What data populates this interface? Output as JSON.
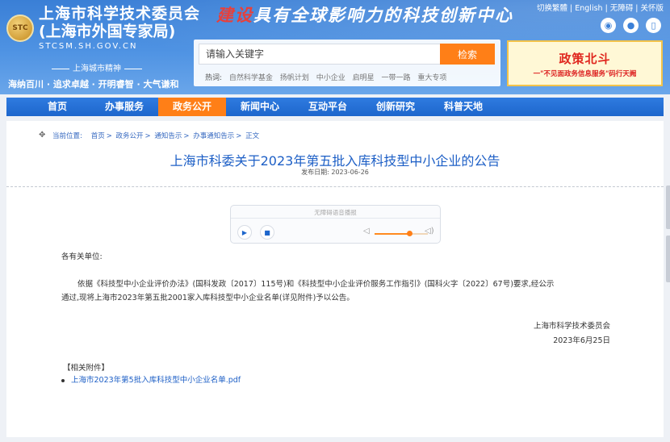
{
  "header": {
    "logo_text": "STC",
    "org_name": "上海市科学技术委员会",
    "org_sub": "(上海市外国专家局)",
    "domain": "STCSM.SH.GOV.CN",
    "spirit_title": "上海城市精神",
    "spirit_text": "海纳百川 · 追求卓越 · 开明睿智 · 大气谦和",
    "slogan_part1": "建设",
    "slogan_part2": "具有全球影响力的科技创新中心",
    "links": [
      "切换繁體",
      "English",
      "无障碍",
      "关怀版"
    ],
    "social_icons": [
      "weibo-icon",
      "wechat-icon",
      "mobile-icon"
    ]
  },
  "search": {
    "placeholder": "请输入关键字",
    "button_label": "检索",
    "hot_label": "热词:",
    "hot_keywords": [
      "自然科学基金",
      "扬帆计划",
      "中小企业",
      "启明星",
      "一带一路",
      "重大专项"
    ]
  },
  "banner": {
    "title": "政策北斗",
    "subtitle": "一\"不见面政务信息服务\"码行天阙"
  },
  "nav": {
    "items": [
      "首页",
      "办事服务",
      "政务公开",
      "新闻中心",
      "互动平台",
      "创新研究",
      "科普天地"
    ],
    "active_index": 2
  },
  "breadcrumb": {
    "label": "当前位置:",
    "items": [
      "首页",
      "政务公开",
      "通知告示",
      "办事通知告示",
      "正文"
    ]
  },
  "article": {
    "title": "上海市科委关于2023年第五批入库科技型中小企业的公告",
    "date_label": "发布日期:",
    "date_value": "2023-06-26",
    "greeting": "各有关单位:",
    "body_line1": "依据《科技型中小企业评价办法》(国科发政〔2017〕115号)和《科技型中小企业评价服务工作指引》(国科火字〔2022〕67号)要求,经公示",
    "body_line2": "通过,现将上海市2023年第五批2001家入库科技型中小企业名单(详见附件)予以公告。",
    "signer": "上海市科学技术委员会",
    "sign_date": "2023年6月25日",
    "attachments_heading": "【相关附件】",
    "attachments": [
      "上海市2023年第5批入库科技型中小企业名单.pdf"
    ]
  },
  "player": {
    "title": "无障碍语音播报",
    "volume": 0.65
  },
  "colors": {
    "primary_blue": "#1d66cc",
    "accent_orange": "#ff7f17",
    "link_blue": "#1d5fc6"
  }
}
